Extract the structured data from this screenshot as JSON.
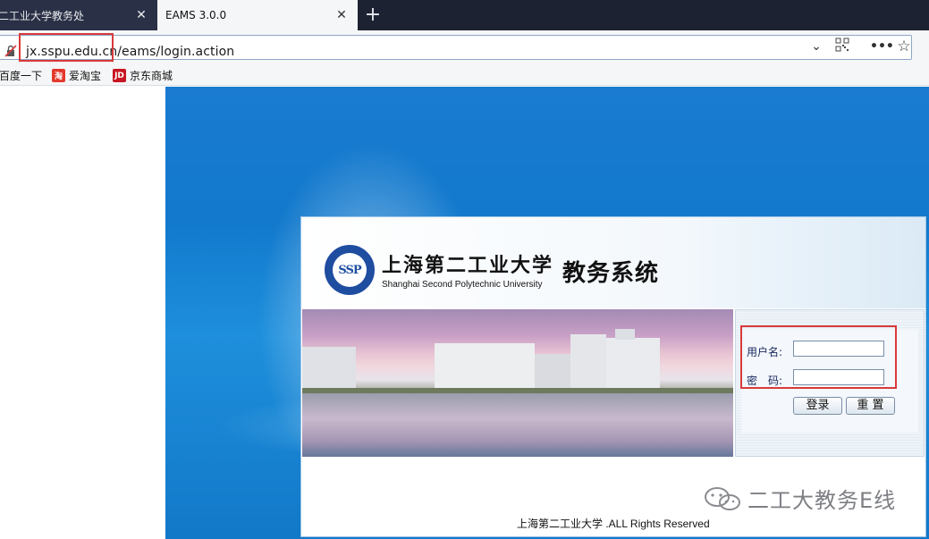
{
  "tabs": [
    {
      "label": "二工业大学教务处"
    },
    {
      "label": "EAMS 3.0.0"
    }
  ],
  "address_bar": {
    "url": "jx.sspu.edu.cn/eams/login.action"
  },
  "bookmarks": [
    {
      "label": "百度一下"
    },
    {
      "label": "爱淘宝",
      "icon": "淘"
    },
    {
      "label": "京东商城",
      "icon": "JD"
    }
  ],
  "header": {
    "university_cn": "上海第二工业大学",
    "university_en": "Shanghai Second Polytechnic University",
    "system_title": "教务系统",
    "logo_text": "SSP"
  },
  "login_form": {
    "username_label": "用户名:",
    "password_label": "密　码:",
    "login_button": "登录",
    "reset_button": "重 置"
  },
  "footer": "上海第二工业大学 .ALL Rights Reserved",
  "watermark": "二工大教务E线",
  "colors": {
    "accent": "#1279cc",
    "highlight": "#d93a3a"
  }
}
